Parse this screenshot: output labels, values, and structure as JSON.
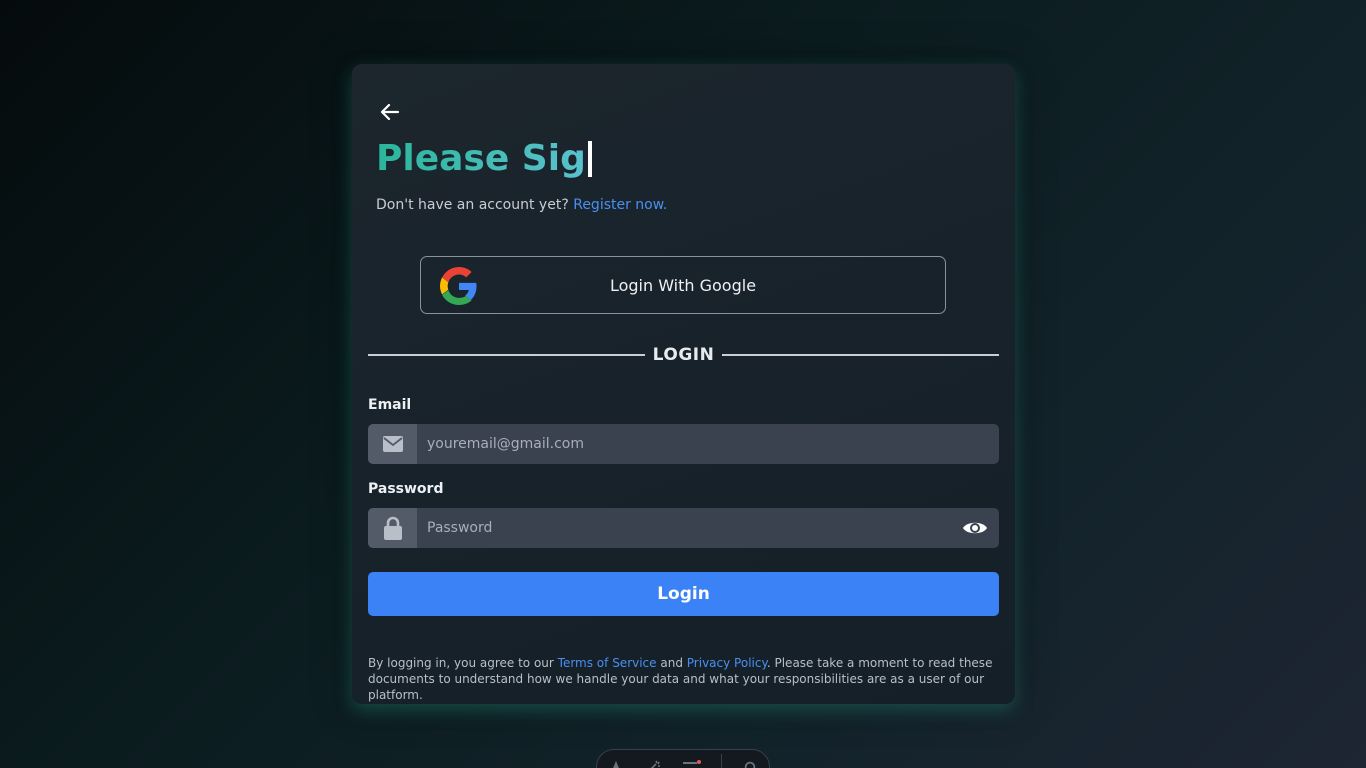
{
  "header": {
    "back_icon": "arrow-left-icon",
    "title": "Please Sig"
  },
  "register": {
    "prompt": "Don't have an account yet?",
    "link": "Register now."
  },
  "google": {
    "label": "Login With Google",
    "icon": "google-icon"
  },
  "divider": {
    "label": "LOGIN"
  },
  "email": {
    "label": "Email",
    "placeholder": "youremail@gmail.com",
    "value": "",
    "icon": "mail-icon"
  },
  "password": {
    "label": "Password",
    "placeholder": "Password",
    "value": "",
    "icon": "lock-icon",
    "toggle_icon": "eye-icon"
  },
  "login_button": {
    "label": "Login"
  },
  "legal": {
    "prefix": "By logging in, you agree to our",
    "terms": "Terms of Service",
    "and": "and",
    "privacy": "Privacy Policy",
    "suffix": ". Please take a moment to read these documents to understand how we handle your data and what your responsibilities are as a user of our platform."
  },
  "colors": {
    "accent": "#3b82f6",
    "link": "#4a8ff0",
    "title_gradient_start": "#2bb59b",
    "title_gradient_end": "#5cc2cf"
  }
}
